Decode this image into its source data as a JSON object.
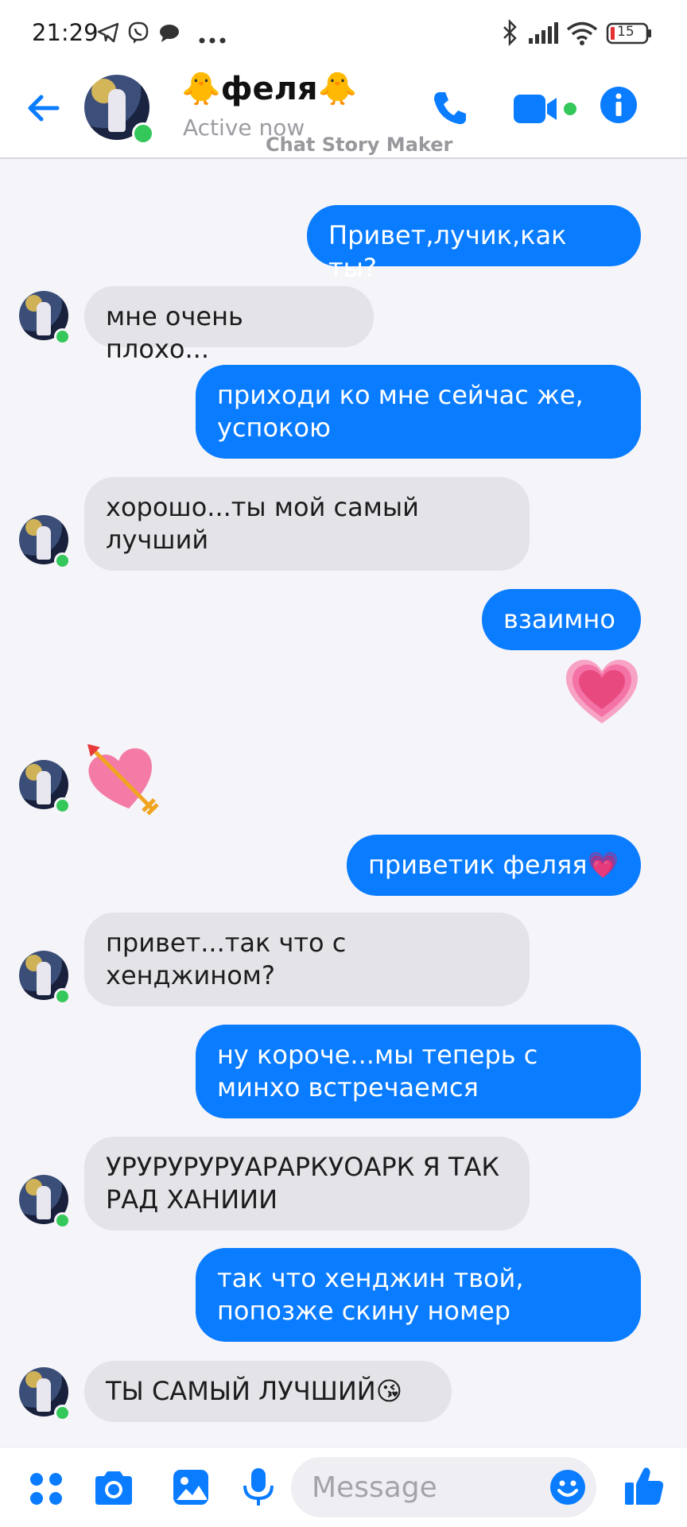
{
  "status_bar": {
    "time": "21:29",
    "battery": "15",
    "icons": [
      "telegram-icon",
      "viber-icon",
      "chat-bubble-icon",
      "more-dots-icon",
      "bluetooth-icon",
      "signal-icon",
      "wifi-icon",
      "battery-icon"
    ]
  },
  "header": {
    "contact_name": "🐥феля🐥",
    "status": "Active now",
    "watermark": "Chat Story Maker",
    "accent_color": "#0a7cff",
    "online_color": "#34c759"
  },
  "messages": [
    {
      "dir": "out",
      "text": "Привет,лучик,как ты?"
    },
    {
      "dir": "in",
      "text": "мне очень плохо..."
    },
    {
      "dir": "out",
      "text": "приходи ко мне сейчас же, успокою"
    },
    {
      "dir": "in",
      "text": "хорошо...ты мой самый лучший"
    },
    {
      "dir": "out",
      "text": "взаимно"
    },
    {
      "dir": "out",
      "emoji": "💗"
    },
    {
      "dir": "in",
      "emoji": "💘"
    },
    {
      "dir": "out",
      "text": "приветик феляя💗"
    },
    {
      "dir": "in",
      "text": "привет...так что с хенджином?"
    },
    {
      "dir": "out",
      "text": "ну короче...мы теперь с минхо встречаемся"
    },
    {
      "dir": "in",
      "text": "УРУРУРУРУАРАРКУОАРК Я ТАК РАД ХАНИИИ"
    },
    {
      "dir": "out",
      "text": "так что хенджин твой, попозже скину номер"
    },
    {
      "dir": "in",
      "text": "ТЫ САМЫЙ ЛУЧШИЙ😘"
    }
  ],
  "composer": {
    "placeholder": "Message",
    "icons": [
      "apps-icon",
      "camera-icon",
      "gallery-icon",
      "microphone-icon",
      "emoji-icon",
      "thumbs-up-icon"
    ]
  }
}
